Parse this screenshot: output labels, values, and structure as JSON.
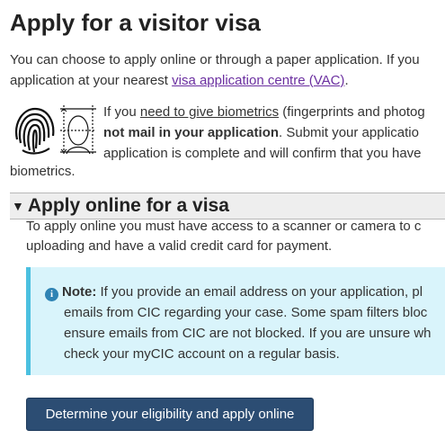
{
  "page": {
    "title": "Apply for a visitor visa",
    "intro_line1": "You can choose to apply online or through a paper application. If you",
    "intro_line2_prefix": "application at your nearest ",
    "intro_link": "visa application centre (VAC)",
    "intro_line2_suffix": "."
  },
  "biometrics": {
    "prefix": "If you ",
    "link": "need to give biometrics",
    "line1_suffix": " (fingerprints and photog",
    "line2_bold": "not mail in your application",
    "line2_suffix": ". Submit your applicatio",
    "line3": "application is complete and will confirm that you have",
    "tail": "biometrics."
  },
  "section": {
    "title": "Apply online for a visa",
    "body_line1": "To apply online you must have access to a scanner or camera to c",
    "body_line2": "uploading and have a valid credit card for payment."
  },
  "note": {
    "label": "Note:",
    "line1": " If you provide an email address on your application, pl",
    "line2": "emails from CIC regarding your case. Some spam filters bloc",
    "line3": "ensure emails from CIC are not blocked. If you are unsure wh",
    "line4": "check your myCIC account on a regular basis."
  },
  "cta": {
    "label": "Determine your eligibility and apply online"
  },
  "icons": {
    "biometrics": "fingerprint-face-icon",
    "info": "info-icon",
    "caret": "caret-down-icon"
  }
}
